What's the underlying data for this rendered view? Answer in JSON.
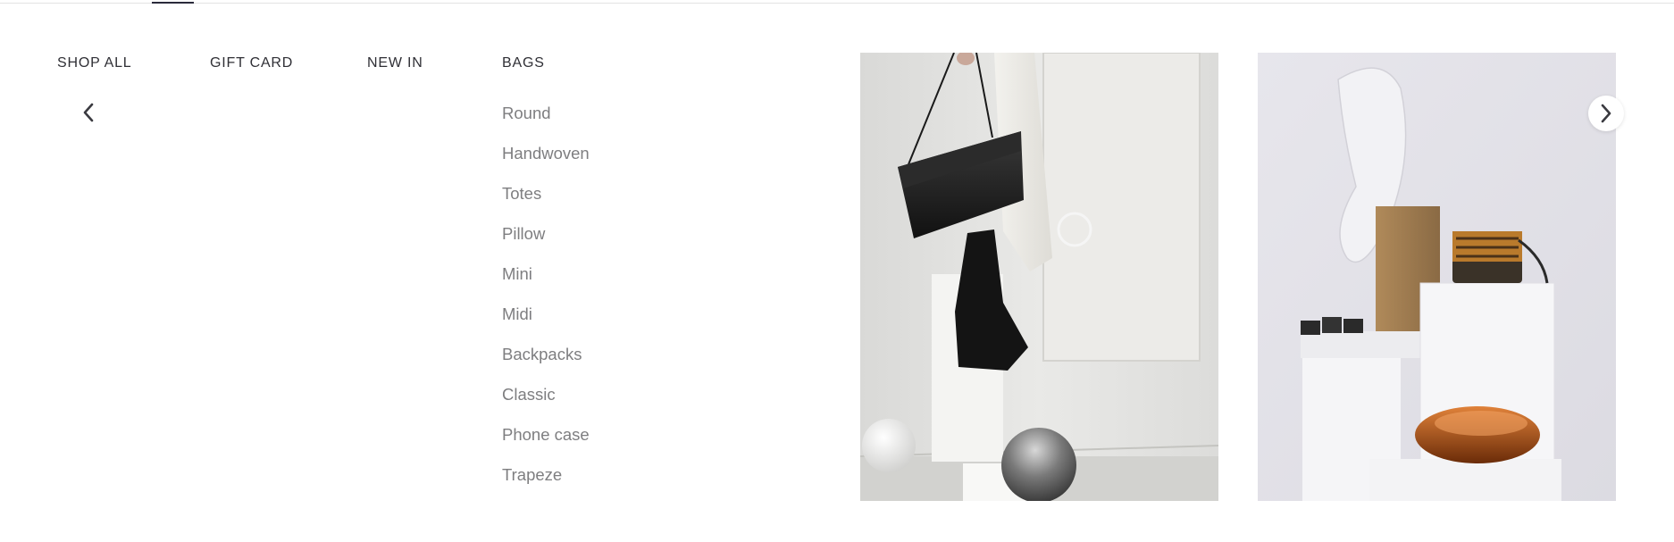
{
  "nav": {
    "items": [
      {
        "label": "SHOP ALL"
      },
      {
        "label": "GIFT CARD"
      },
      {
        "label": "NEW IN"
      },
      {
        "label": "BAGS"
      }
    ]
  },
  "submenu": {
    "items": [
      {
        "label": "Round"
      },
      {
        "label": "Handwoven"
      },
      {
        "label": "Totes"
      },
      {
        "label": "Pillow"
      },
      {
        "label": "Mini"
      },
      {
        "label": "Midi"
      },
      {
        "label": "Backpacks"
      },
      {
        "label": "Classic"
      },
      {
        "label": "Phone case"
      },
      {
        "label": "Trapeze"
      }
    ]
  },
  "icons": {
    "back": "chevron-left-icon",
    "next": "chevron-right-icon"
  },
  "colors": {
    "nav_text": "#2f2f35",
    "submenu_text": "#7e7e80",
    "indicator": "#2a2a3a"
  }
}
